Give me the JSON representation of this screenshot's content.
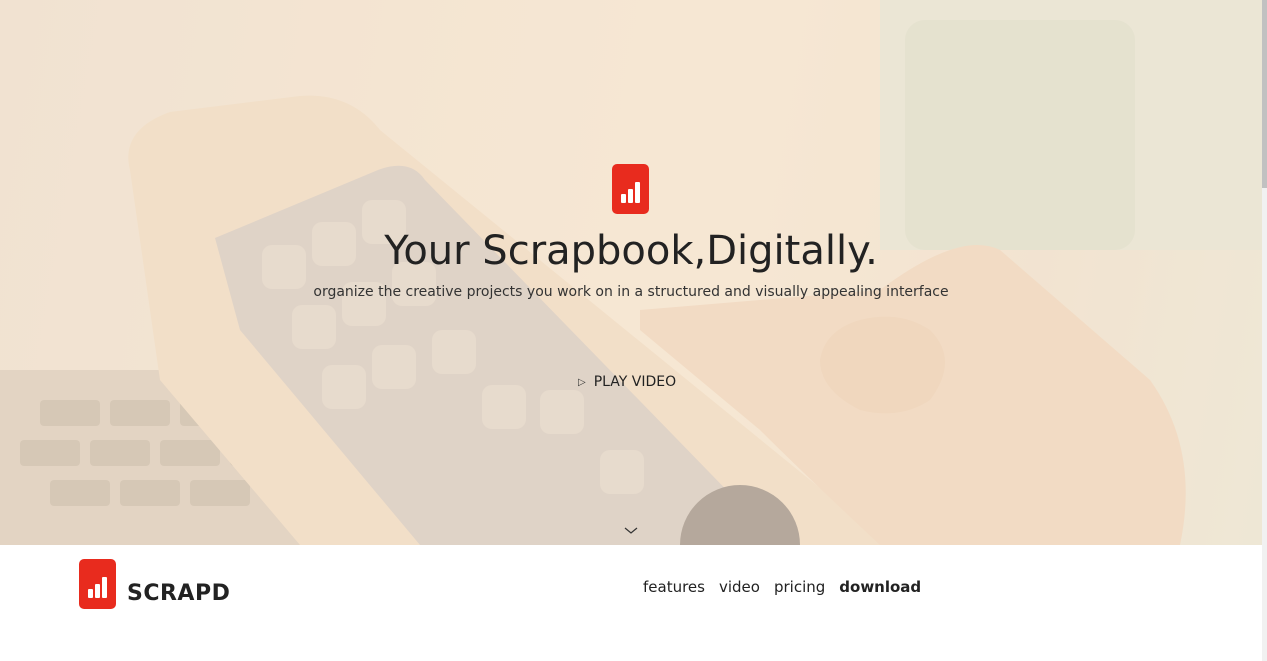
{
  "hero": {
    "title": "Your Scrapbook,Digitally.",
    "subtitle": "organize the creative projects you work on in a structured and visually appealing interface",
    "play_label": "PLAY VIDEO",
    "play_icon": "play-outline-icon",
    "scroll_icon": "chevron-down-icon"
  },
  "navbar": {
    "brand": "SCRAPD",
    "links": [
      "features",
      "video",
      "pricing",
      "download"
    ],
    "active_link": "download"
  },
  "colors": {
    "brand_red": "#e82b1e",
    "overlay": "#fae8d2",
    "text": "#222222"
  }
}
